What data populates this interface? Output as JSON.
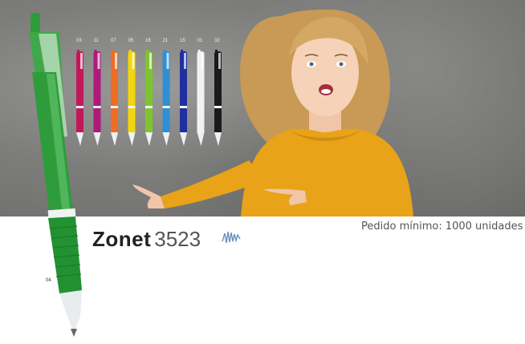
{
  "product": {
    "brand": "Zonet",
    "model": "3523",
    "min_order": "Pedido mínimo: 1000 unidades",
    "main_color_code": "04"
  },
  "variants": [
    {
      "code": "03",
      "color": "#c2185b"
    },
    {
      "code": "11",
      "color": "#b0197c"
    },
    {
      "code": "07",
      "color": "#ef6c24"
    },
    {
      "code": "05",
      "color": "#f4d60a"
    },
    {
      "code": "16",
      "color": "#7cc62c"
    },
    {
      "code": "21",
      "color": "#2e8fd4"
    },
    {
      "code": "15",
      "color": "#1f2fa0"
    },
    {
      "code": "01",
      "color": "#f2f2f2"
    },
    {
      "code": "32",
      "color": "#1a1a1a"
    }
  ],
  "colors": {
    "accent_green": "#2e9b3a",
    "sweater": "#e8a318",
    "signature": "#6a8fc0"
  }
}
